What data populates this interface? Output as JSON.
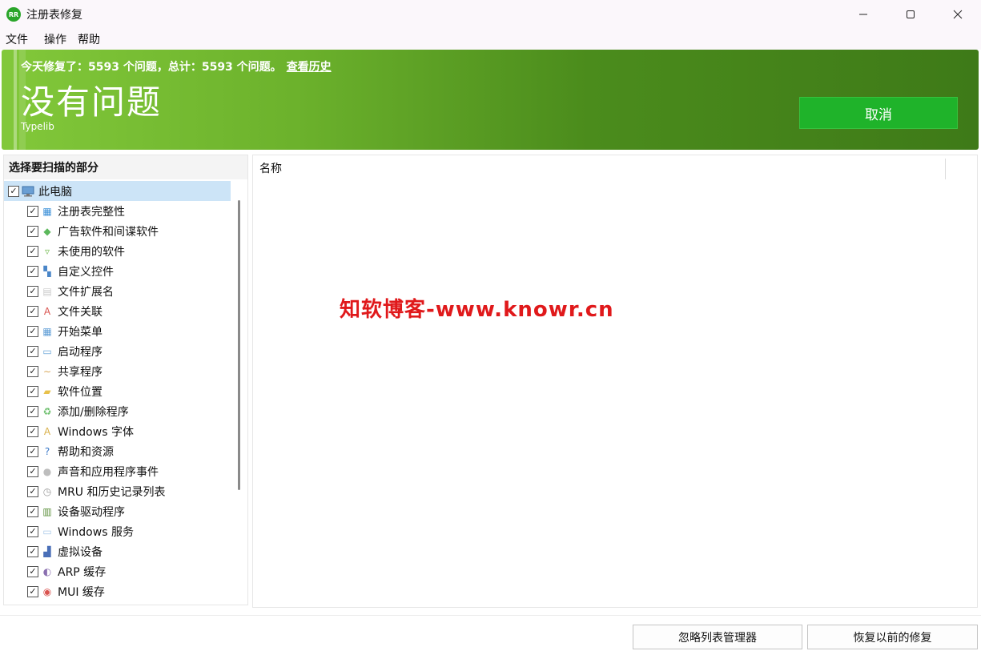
{
  "window": {
    "title": "注册表修复",
    "app_icon_text": "RR",
    "controls": {
      "minimize": "—",
      "maximize": "☐",
      "close": "✕"
    }
  },
  "menu": [
    "文件",
    "操作",
    "帮助"
  ],
  "banner": {
    "summary": "今天修复了：5593 个问题，总计：5593 个问题。",
    "history_link": "查看历史",
    "status": "没有问题",
    "current_item": "Typelib",
    "cancel_label": "取消"
  },
  "scan_tree": {
    "header": "选择要扫描的部分",
    "root": {
      "label": "此电脑",
      "checked": true,
      "icon": "computer-icon"
    },
    "items": [
      {
        "label": "注册表完整性",
        "icon": "registry-icon",
        "checked": true
      },
      {
        "label": "广告软件和间谍软件",
        "icon": "shield-icon",
        "checked": true
      },
      {
        "label": "未使用的软件",
        "icon": "recycle-bin-icon",
        "checked": true
      },
      {
        "label": "自定义控件",
        "icon": "controls-icon",
        "checked": true
      },
      {
        "label": "文件扩展名",
        "icon": "file-icon",
        "checked": true
      },
      {
        "label": "文件关联",
        "icon": "file-association-icon",
        "checked": true
      },
      {
        "label": "开始菜单",
        "icon": "start-menu-icon",
        "checked": true
      },
      {
        "label": "启动程序",
        "icon": "startup-icon",
        "checked": true
      },
      {
        "label": "共享程序",
        "icon": "share-icon",
        "checked": true
      },
      {
        "label": "软件位置",
        "icon": "folder-icon",
        "checked": true
      },
      {
        "label": "添加/删除程序",
        "icon": "add-remove-icon",
        "checked": true
      },
      {
        "label": "Windows 字体",
        "icon": "font-icon",
        "checked": true
      },
      {
        "label": "帮助和资源",
        "icon": "help-icon",
        "checked": true
      },
      {
        "label": "声音和应用程序事件",
        "icon": "sound-icon",
        "checked": true
      },
      {
        "label": "MRU 和历史记录列表",
        "icon": "history-icon",
        "checked": true
      },
      {
        "label": "设备驱动程序",
        "icon": "driver-icon",
        "checked": true
      },
      {
        "label": "Windows 服务",
        "icon": "service-icon",
        "checked": true
      },
      {
        "label": "虚拟设备",
        "icon": "virtual-device-icon",
        "checked": true
      },
      {
        "label": "ARP 缓存",
        "icon": "arp-icon",
        "checked": true
      },
      {
        "label": "MUI 缓存",
        "icon": "mui-icon",
        "checked": true
      }
    ]
  },
  "results": {
    "column_name": "名称",
    "watermark": "知软博客-www.knowr.cn"
  },
  "buttons": {
    "ignore_list": "忽略列表管理器",
    "restore": "恢复以前的修复"
  },
  "colors": {
    "banner_start": "#82c83a",
    "banner_end": "#3e7a18",
    "cancel_button": "#1fb32a",
    "selected_row": "#cce4f7",
    "watermark": "#e0191b"
  }
}
